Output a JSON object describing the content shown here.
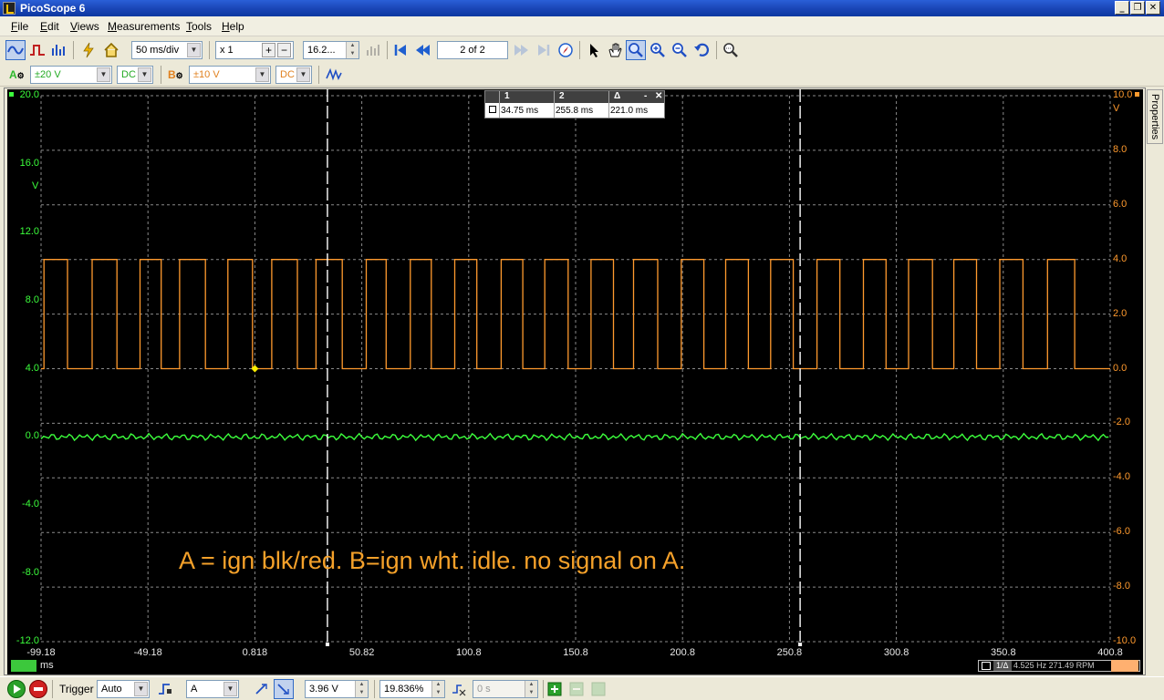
{
  "window": {
    "title": "PicoScope 6"
  },
  "menu": [
    {
      "label": "File",
      "key": "F",
      "rest": "ile"
    },
    {
      "label": "Edit",
      "key": "E",
      "rest": "dit"
    },
    {
      "label": "Views",
      "key": "V",
      "rest": "iews"
    },
    {
      "label": "Measurements",
      "key": "M",
      "rest": "easurements"
    },
    {
      "label": "Tools",
      "key": "T",
      "rest": "ools"
    },
    {
      "label": "Help",
      "key": "H",
      "rest": "elp"
    }
  ],
  "toolbar": {
    "timebase": "50 ms/div",
    "zoom": "x 1",
    "samples": "16.2...",
    "buffer_page": "2 of 2"
  },
  "channels": {
    "a": {
      "label": "A",
      "range": "±20 V",
      "coupling": "DC",
      "color": "#3cff3c"
    },
    "b": {
      "label": "B",
      "range": "±10 V",
      "coupling": "DC",
      "color": "#ff9a2e"
    }
  },
  "scope": {
    "left_axis_unit": "V",
    "right_axis_unit": "V",
    "left_ticks": [
      "20.0",
      "16.0",
      "12.0",
      "8.0",
      "4.0",
      "0.0",
      "-4.0",
      "-8.0",
      "-12.0"
    ],
    "right_ticks": [
      "10.0",
      "8.0",
      "6.0",
      "4.0",
      "2.0",
      "0.0",
      "-2.0",
      "-4.0",
      "-6.0",
      "-8.0",
      "-10.0"
    ],
    "x_ticks": [
      "-99.18",
      "-49.18",
      "0.818",
      "50.82",
      "100.8",
      "150.8",
      "200.8",
      "250.8",
      "300.8",
      "350.8",
      "400.8"
    ],
    "x_unit": "ms",
    "annotation": "A = ign blk/red.  B=ign wht.  idle.  no signal on A.",
    "trigger_marker": {
      "time_ms": 0.818,
      "level_v": 4.0
    },
    "rulers": {
      "col1": "1",
      "col2": "2",
      "col3": "Δ",
      "ruler1": "34.75 ms",
      "ruler2": "255.8 ms",
      "delta": "221.0 ms"
    },
    "frequency_readout": {
      "tag": "1/Δ",
      "text": "4.525 Hz   271.49 RPM"
    }
  },
  "properties_tab": "Properties",
  "trigger_bar": {
    "trigger_label": "Trigger",
    "mode": "Auto",
    "source": "A",
    "threshold": "3.96 V",
    "pre_trigger": "19.836%",
    "delay": "0 s"
  },
  "chart_data": {
    "type": "line",
    "series": [
      {
        "name": "A",
        "axis": "left",
        "color": "#3cff3c",
        "description": "flat ~0 V noise",
        "values_v": [
          0.0
        ]
      },
      {
        "name": "B",
        "axis": "right",
        "color": "#ff9a2e",
        "high_v": 4.0,
        "low_v": 0.0,
        "rising_edges_ms": [
          -97.8,
          -75.3,
          -52.9,
          -34.4,
          -11.8,
          8.7,
          29.4,
          52.9,
          73.5,
          94.3,
          116.0,
          136.4,
          158.0,
          177.9,
          200.2,
          221.0,
          242.0,
          263.7,
          285.4,
          306.5,
          327.7,
          349.2,
          371.5
        ],
        "falling_edges_ms": [
          -86.8,
          -63.7,
          -43.0,
          -22.3,
          -0.3,
          20.7,
          41.7,
          62.2,
          83.3,
          104.6,
          126.1,
          147.3,
          168.5,
          189.2,
          210.8,
          231.6,
          252.6,
          274.4,
          296.0,
          317.7,
          338.3,
          360.0,
          384.2
        ]
      }
    ],
    "x_range_ms": [
      -99.18,
      400.8
    ],
    "left_ylim_v": [
      -12.0,
      20.0
    ],
    "right_ylim_v": [
      -10.0,
      10.0
    ]
  }
}
